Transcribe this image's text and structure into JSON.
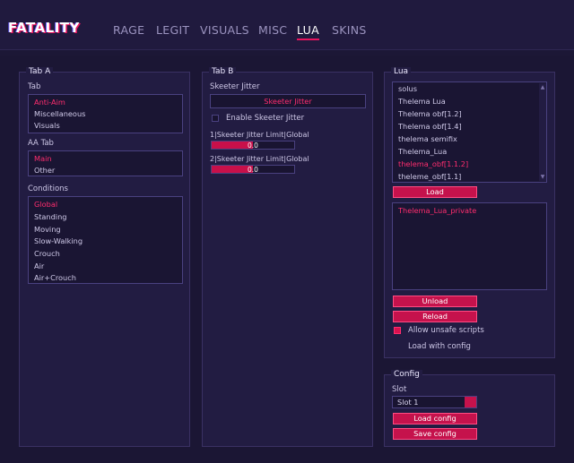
{
  "app": {
    "logo": "FATALITY",
    "tabs": [
      "RAGE",
      "LEGIT",
      "VISUALS",
      "MISC",
      "LUA",
      "SKINS"
    ],
    "active_tab": "LUA"
  },
  "colors": {
    "accent": "#e8145e",
    "selected_text": "#ff2d6e",
    "background": "#1c1736",
    "panel": "#221c42"
  },
  "tab_a": {
    "title": "Tab A",
    "tab_label": "Tab",
    "tab_items": [
      "Anti-Aim",
      "Miscellaneous",
      "Visuals"
    ],
    "aa_tab_label": "AA Tab",
    "aa_tab_items": [
      "Main",
      "Other"
    ],
    "conditions_label": "Conditions",
    "conditions_items": [
      "Global",
      "Standing",
      "Moving",
      "Slow-Walking",
      "Crouch",
      "Air",
      "Air+Crouch"
    ]
  },
  "tab_b": {
    "title": "Tab B",
    "jitter_label": "Skeeter Jitter",
    "jitter_value": "Skeeter Jitter",
    "enable_label": "Enable Skeeter Jitter",
    "slider1_label": "1|Skeeter Jitter Limit|Global",
    "slider1_value": "0.0",
    "slider1_fill": 0.5,
    "slider2_label": "2|Skeeter Jitter Limit|Global",
    "slider2_value": "0.0",
    "slider2_fill": 0.5
  },
  "lua": {
    "title": "Lua",
    "scripts": [
      "solus",
      "Thelema Lua",
      "Thelema obf[1.2]",
      "Thelema obf[1.4]",
      "thelema semifix",
      "Thelema_Lua",
      "thelema_obf[1.1.2]",
      "theleme_obf[1.1]"
    ],
    "selected_script": "thelema_obf[1.1.2]",
    "load_label": "Load",
    "loaded_scripts": [
      "Thelema_Lua_private"
    ],
    "unload_label": "Unload",
    "reload_label": "Reload",
    "allow_unsafe_label": "Allow unsafe scripts",
    "allow_unsafe_checked": true,
    "load_with_config_label": "Load with config",
    "load_with_config_checked": false
  },
  "config": {
    "title": "Config",
    "slot_label": "Slot",
    "slot_value": "Slot 1",
    "load_config_label": "Load config",
    "save_config_label": "Save config"
  }
}
